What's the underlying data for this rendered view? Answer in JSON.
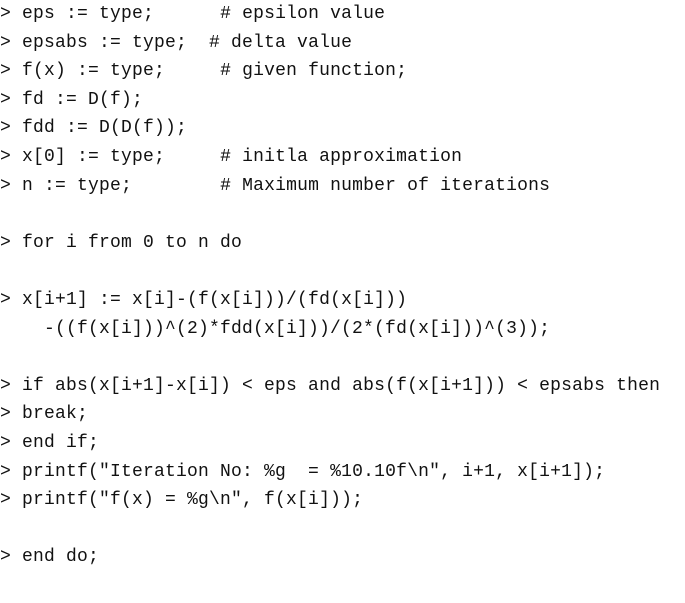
{
  "prompt": "> ",
  "lines": [
    {
      "prompt": true,
      "code": "eps := type;      ",
      "comment": "# epsilon value"
    },
    {
      "prompt": true,
      "code": "epsabs := type;  ",
      "comment": "# delta value"
    },
    {
      "prompt": true,
      "code": "f(x) := type;     ",
      "comment": "# given function;"
    },
    {
      "prompt": true,
      "code": "fd := D(f);",
      "comment": ""
    },
    {
      "prompt": true,
      "code": "fdd := D(D(f));",
      "comment": ""
    },
    {
      "prompt": true,
      "code": "x[0] := type;     ",
      "comment": "# initla approximation"
    },
    {
      "prompt": true,
      "code": "n := type;        ",
      "comment": "# Maximum number of iterations"
    },
    {
      "prompt": false,
      "code": "",
      "comment": ""
    },
    {
      "prompt": true,
      "code": "for i from 0 to n do",
      "comment": ""
    },
    {
      "prompt": false,
      "code": "",
      "comment": ""
    },
    {
      "prompt": true,
      "code": "x[i+1] := x[i]-(f(x[i]))/(fd(x[i]))",
      "comment": ""
    },
    {
      "prompt": false,
      "code": "    -((f(x[i]))^(2)*fdd(x[i]))/(2*(fd(x[i]))^(3));",
      "comment": ""
    },
    {
      "prompt": false,
      "code": "",
      "comment": ""
    },
    {
      "prompt": true,
      "code": "if abs(x[i+1]-x[i]) < eps and abs(f(x[i+1])) < epsabs then",
      "comment": ""
    },
    {
      "prompt": true,
      "code": "break;",
      "comment": ""
    },
    {
      "prompt": true,
      "code": "end if;",
      "comment": ""
    },
    {
      "prompt": true,
      "code": "printf(\"Iteration No: %g  = %10.10f\\n\", i+1, x[i+1]);",
      "comment": ""
    },
    {
      "prompt": true,
      "code": "printf(\"f(x) = %g\\n\", f(x[i]));",
      "comment": ""
    },
    {
      "prompt": false,
      "code": "",
      "comment": ""
    },
    {
      "prompt": true,
      "code": "end do;",
      "comment": ""
    }
  ]
}
